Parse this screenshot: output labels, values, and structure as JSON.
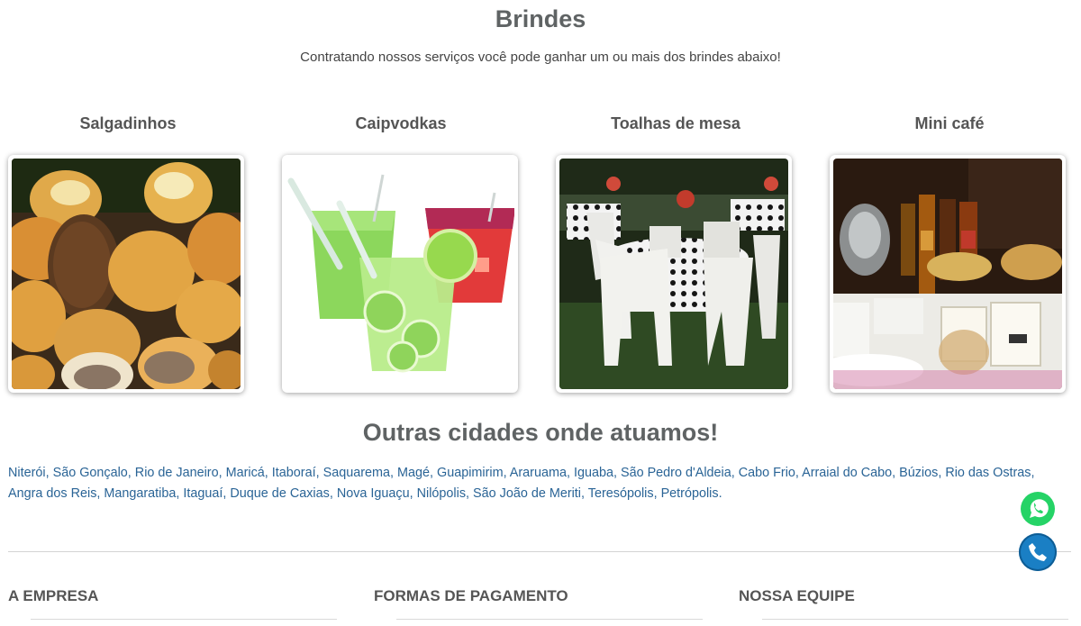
{
  "header": {
    "title": "Brindes",
    "subtitle": "Contratando nossos serviços você pode ganhar um ou mais dos brindes abaixo!"
  },
  "gifts": [
    {
      "name": "Salgadinhos",
      "icon": "salgadinhos-photo"
    },
    {
      "name": "Caipvodkas",
      "icon": "caipvodkas-photo"
    },
    {
      "name": "Toalhas de mesa",
      "icon": "toalhas-photo"
    },
    {
      "name": "Mini café",
      "icon": "mini-cafe-photo"
    }
  ],
  "cities": {
    "title": "Outras cidades onde atuamos!",
    "list": [
      "Niterói",
      "São Gonçalo",
      "Rio de Janeiro",
      "Maricá",
      "Itaboraí",
      "Saquarema",
      "Magé",
      "Guapimirim",
      "Araruama",
      "Iguaba",
      "São Pedro d'Aldeia",
      "Cabo Frio",
      "Arraial do Cabo",
      "Búzios",
      "Rio das Ostras",
      "Angra dos Reis",
      "Mangaratiba",
      "Itaguaí",
      "Duque de Caxias",
      "Nova Iguaçu",
      "Nilópolis",
      "São João de Meriti",
      "Teresópolis",
      "Petrópolis"
    ]
  },
  "footer": {
    "col1": "A EMPRESA",
    "col2": "FORMAS DE PAGAMENTO",
    "col3": "NOSSA EQUIPE"
  },
  "floating": {
    "whatsapp_icon": "whatsapp-icon",
    "phone_icon": "phone-icon"
  },
  "colors": {
    "link": "#2a6496",
    "heading": "#5f6364",
    "whatsapp": "#25d366",
    "phone": "#1a7fc4"
  }
}
